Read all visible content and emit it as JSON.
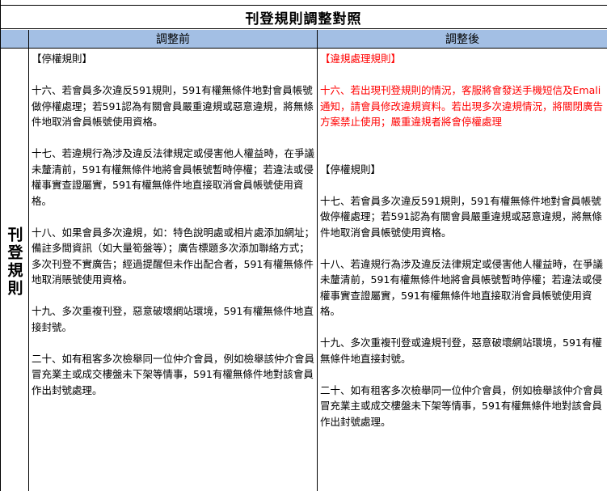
{
  "document": {
    "title": "刊登規則調整對照",
    "headers": {
      "before": "調整前",
      "after": "調整後"
    },
    "side_label": "刊登規則",
    "before": {
      "heading": "【停權規則】",
      "rules": [
        "十六、若會員多次違反591規則，591有權無條件地對會員帳號做停權處理；若591認為有關會員嚴重違規或惡意違規，將無條件地取消會員帳號使用資格。",
        "十七、若違規行為涉及違反法律規定或侵害他人權益時，在爭議未釐清前，591有權無條件地將會員帳號暫時停權；若違法或侵權事實查證屬實，591有權無條件地直接取消會員帳號使用資格。",
        "十八、如果會員多次違規，如：特色說明處或相片處添加網址；備註多間資訊（如大量筍盤等）；廣告標題多次添加聯絡方式；多次刊登不實廣告；經過提醒但未作出配合者，591有權無條件地取消賬號使用資格。",
        "十九、多次重複刊登，惡意破壞網站環境，591有權無條件地直接封號。",
        "二十、如有租客多次檢舉同一位仲介會員，例如檢舉該仲介會員冒充業主或成交樓盤未下架等情事，591有權無條件地對該會員作出封號處理。"
      ]
    },
    "after": {
      "violation_heading": "【違規處理規則】",
      "violation_rule": "十六、若出現刊登規則的情況，客服將會發送手機短信及Emali通知，請會員修改違規資料。若出現多次違規情況，將關閉廣告方案禁止使用；嚴重違規者將會停權處理",
      "heading": "【停權規則】",
      "rules": [
        "十七、若會員多次違反591規則，591有權無條件地對會員帳號做停權處理；若591認為有關會員嚴重違規或惡意違規，將無條件地取消會員帳號使用資格。",
        "十八、若違規行為涉及違反法律規定或侵害他人權益時，在爭議未釐清前，591有權無條件地將會員帳號暫時停權；若違法或侵權事實查證屬實，591有權無條件地直接取消會員帳號使用資格。",
        "十九、多次重複刊登或違規刊登，惡意破壞網站環境，591有權無條件地直接封號。",
        "二十、如有租客多次檢舉同一位仲介會員，例如檢舉該仲介會員冒充業主或成交樓盤未下架等情事，591有權無條件地對該會員作出封號處理。"
      ]
    }
  },
  "colors": {
    "header_bg": "#a3bfe4",
    "highlight": "#ff0000"
  }
}
